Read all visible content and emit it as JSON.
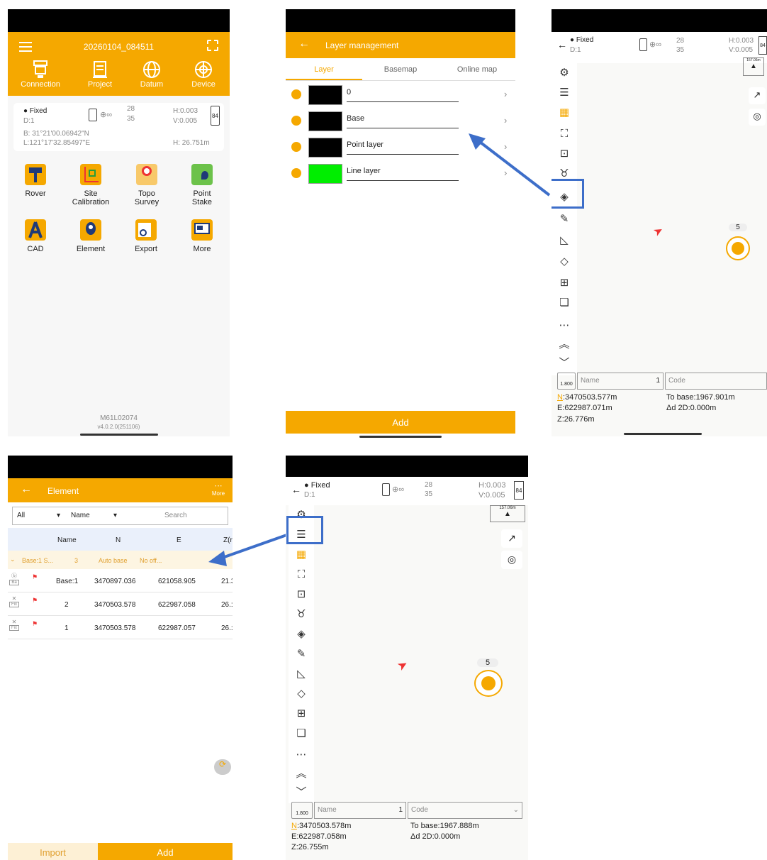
{
  "home": {
    "title": "20260104_084511",
    "nav": [
      {
        "label": "Connection",
        "icon": "receiver-icon"
      },
      {
        "label": "Project",
        "icon": "project-icon"
      },
      {
        "label": "Datum",
        "icon": "globe-icon"
      },
      {
        "label": "Device",
        "icon": "device-globe-icon"
      }
    ],
    "status": {
      "fix": "Fixed",
      "diff": "D:1",
      "sats_top": "28",
      "sats_bottom": "35",
      "h": "H:0.003",
      "v": "V:0.005",
      "battery": "84",
      "lat": "B: 31°21'00.06942\"N",
      "lon": "L:121°17'32.85497\"E",
      "height": "H: 26.751m"
    },
    "apps": [
      {
        "label": "Rover",
        "icon": "rover-icon"
      },
      {
        "label": "Site\nCalibration",
        "icon": "site-calibration-icon"
      },
      {
        "label": "Topo\nSurvey",
        "icon": "topo-survey-icon"
      },
      {
        "label": "Point\nStake",
        "icon": "point-stake-icon"
      },
      {
        "label": "CAD",
        "icon": "cad-icon"
      },
      {
        "label": "Element",
        "icon": "element-icon"
      },
      {
        "label": "Export",
        "icon": "export-icon"
      },
      {
        "label": "More",
        "icon": "more-icon"
      }
    ],
    "device_id": "M61L02074",
    "version": "v4.0.2.0(251106)"
  },
  "layers": {
    "title": "Layer management",
    "tabs": [
      "Layer",
      "Basemap",
      "Online map"
    ],
    "active_tab": "Layer",
    "rows": [
      {
        "name": "0",
        "color": "#000000"
      },
      {
        "name": "Base",
        "color": "#000000"
      },
      {
        "name": "Point layer",
        "color": "#000000"
      },
      {
        "name": "Line layer",
        "color": "#00ee00"
      }
    ],
    "add_label": "Add"
  },
  "map_top": {
    "fix": "Fixed",
    "diff": "D:1",
    "sats_top": "28",
    "sats_bottom": "35",
    "h": "H:0.003",
    "v": "V:0.005",
    "battery": "84",
    "scale": "157.06m",
    "cluster_count": "5",
    "pole_height": "1.800",
    "name_placeholder": "Name",
    "point_number": "1",
    "code_placeholder": "Code",
    "n": "3470503.577m",
    "e": "E:622987.071m",
    "z": "Z:26.776m",
    "to_base": "To base:1967.901m",
    "d2d": "Δd 2D:0.000m"
  },
  "element": {
    "title": "Element",
    "more_label": "More",
    "filter_all": "All",
    "filter_field": "Name",
    "search_placeholder": "Search",
    "columns": [
      "Name",
      "N",
      "E",
      "Z(r"
    ],
    "group": {
      "name": "Base:1 S...",
      "count": "3",
      "type": "Auto base",
      "offset": "No off..."
    },
    "rows": [
      {
        "tag": "Ba",
        "name": "Base:1",
        "n": "3470897.036",
        "e": "621058.905",
        "z": "21.3"
      },
      {
        "tag": "Fix",
        "name": "2",
        "n": "3470503.578",
        "e": "622987.058",
        "z": "26.:"
      },
      {
        "tag": "Fix",
        "name": "1",
        "n": "3470503.578",
        "e": "622987.057",
        "z": "26.:"
      }
    ],
    "import_label": "Import",
    "add_label": "Add"
  },
  "map_bottom": {
    "fix": "Fixed",
    "diff": "D:1",
    "sats_top": "28",
    "sats_bottom": "35",
    "h": "H:0.003",
    "v": "V:0.005",
    "battery": "84",
    "scale": "157.06m",
    "cluster_count": "5",
    "pole_height": "1.800",
    "name_placeholder": "Name",
    "point_number": "1",
    "code_placeholder": "Code",
    "n": "3470503.578m",
    "e": "E:622987.058m",
    "z": "Z:26.755m",
    "to_base": "To base:1967.888m",
    "d2d": "Δd 2D:0.000m"
  },
  "colors": {
    "accent": "#f5a800",
    "highlight": "#3d6ec9",
    "nav_icon": "#1f3a78"
  }
}
